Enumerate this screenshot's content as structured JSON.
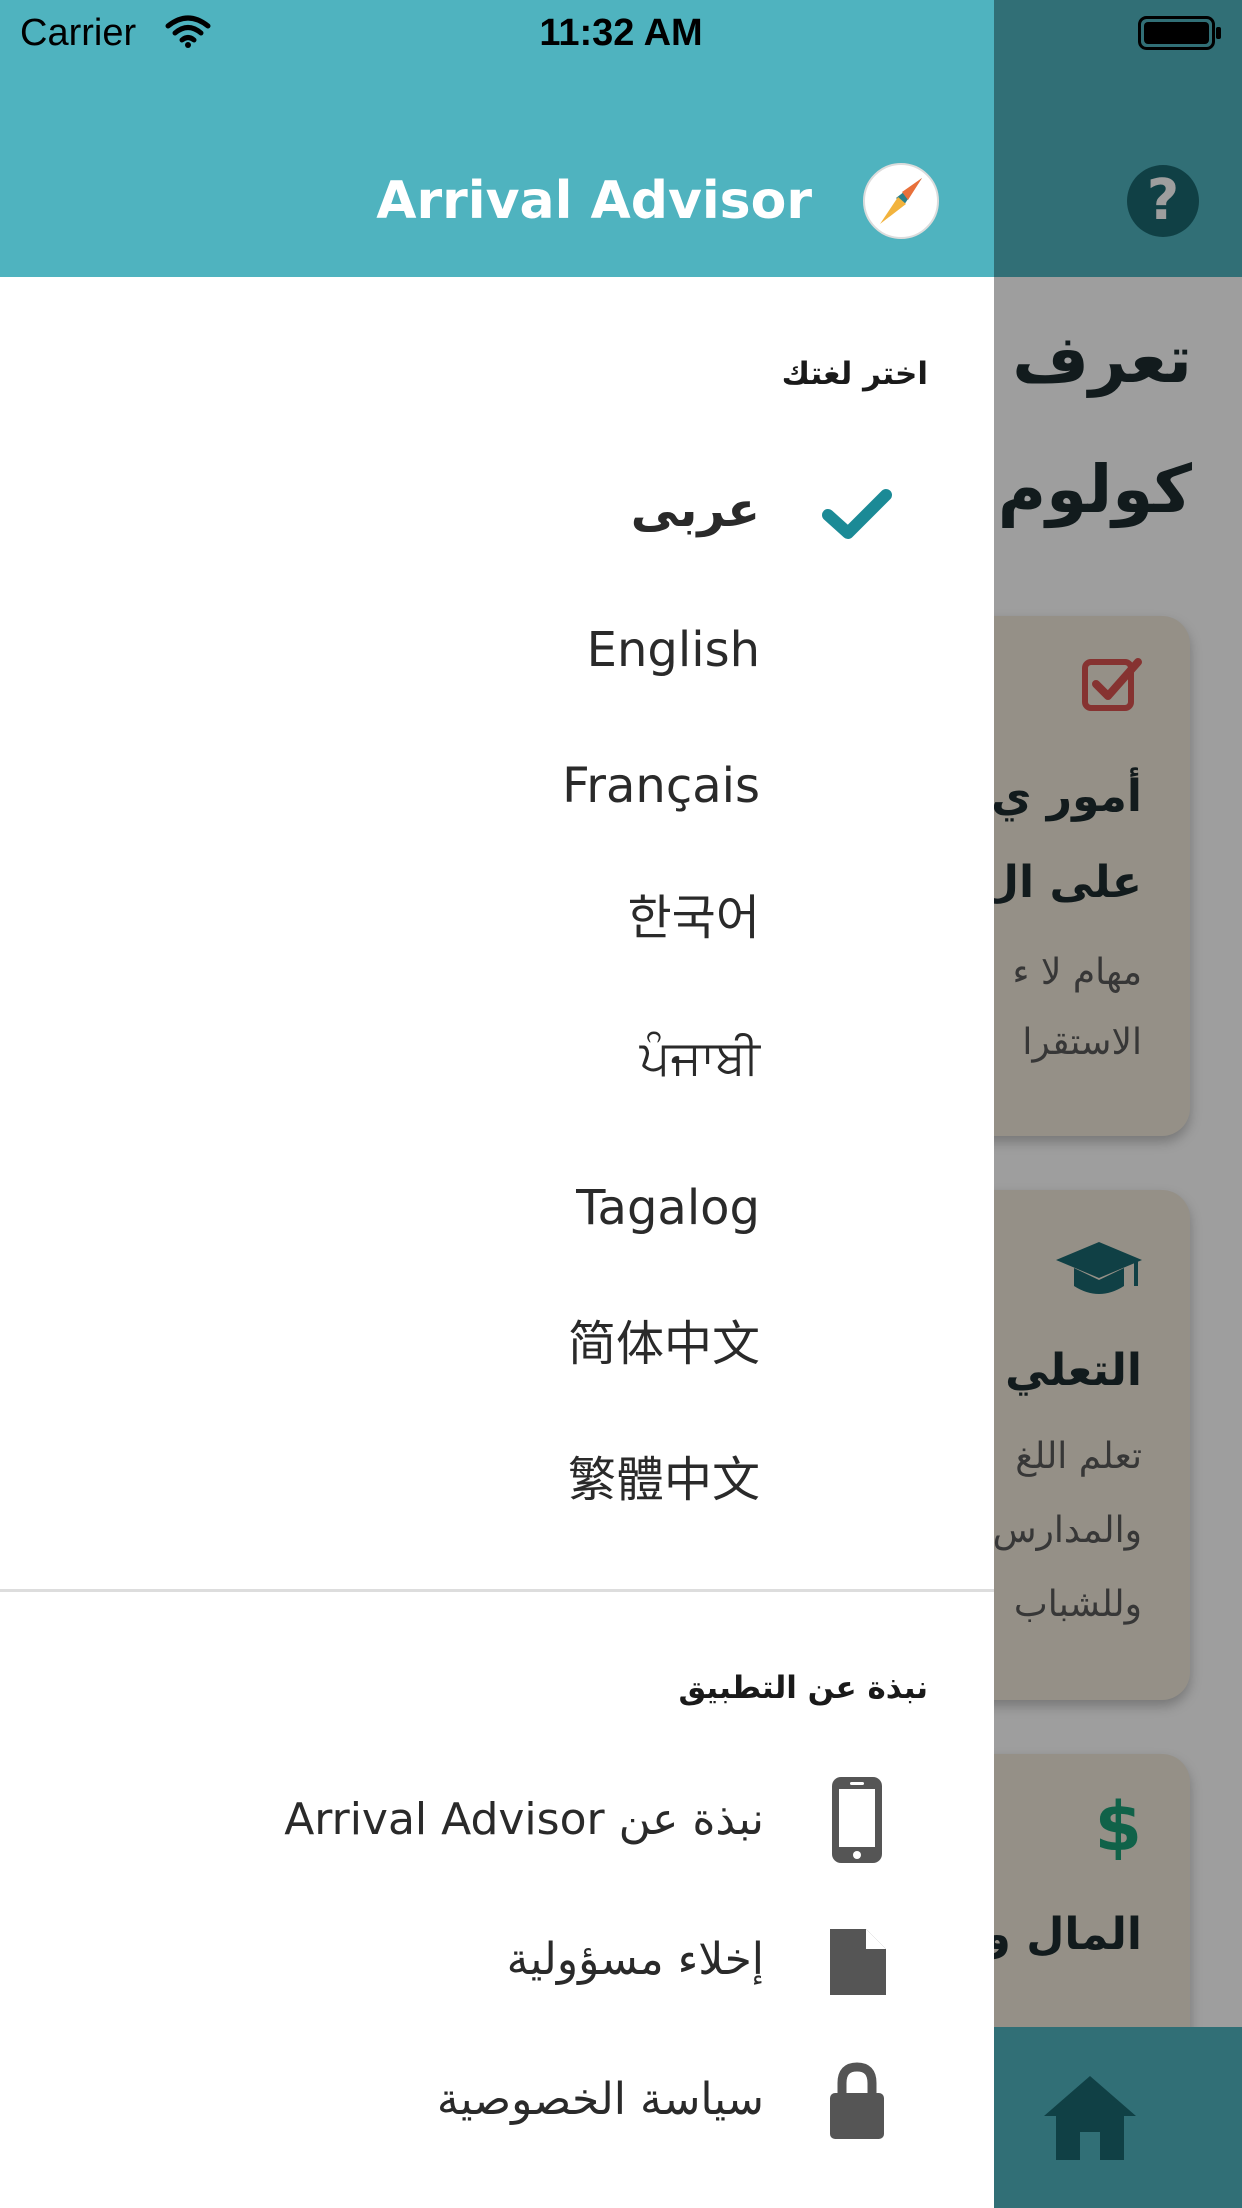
{
  "status_bar": {
    "carrier": "Carrier",
    "time": "11:32 AM"
  },
  "app": {
    "title": "Arrival Advisor"
  },
  "background": {
    "title_line1": "تعرف",
    "title_line2": "كولوم",
    "cards": [
      {
        "icon": "checkbox-icon",
        "heading1": "أمور ي",
        "heading2": "على ال",
        "text1": "مهام لا ء",
        "text2": "الاستقرا"
      },
      {
        "icon": "graduation-cap-icon",
        "heading1": "التعلي",
        "text1": "تعلم اللغ",
        "text2": "والمدارس",
        "text3": "وللشباب"
      },
      {
        "icon": "dollar-icon",
        "heading1": "المال و"
      }
    ]
  },
  "drawer": {
    "language_section_label": "اختر لغتك",
    "languages": [
      {
        "label": "عربى",
        "selected": true
      },
      {
        "label": "English",
        "selected": false
      },
      {
        "label": "Français",
        "selected": false
      },
      {
        "label": "한국어",
        "selected": false
      },
      {
        "label": "ਪੰਜਾਬੀ",
        "selected": false
      },
      {
        "label": "Tagalog",
        "selected": false
      },
      {
        "label": "简体中文",
        "selected": false
      },
      {
        "label": "繁體中文",
        "selected": false
      }
    ],
    "about_section_label": "نبذة عن التطبيق",
    "about_items": [
      {
        "label": "نبذة عن Arrival Advisor",
        "icon": "phone-icon"
      },
      {
        "label": "إخلاء مسؤولية",
        "icon": "document-icon"
      },
      {
        "label": "سياسة الخصوصية",
        "icon": "lock-icon"
      }
    ]
  },
  "colors": {
    "header": "#4fb3bf",
    "accent": "#1b8a96",
    "text": "#2a2a2a",
    "icon_gray": "#555555"
  }
}
